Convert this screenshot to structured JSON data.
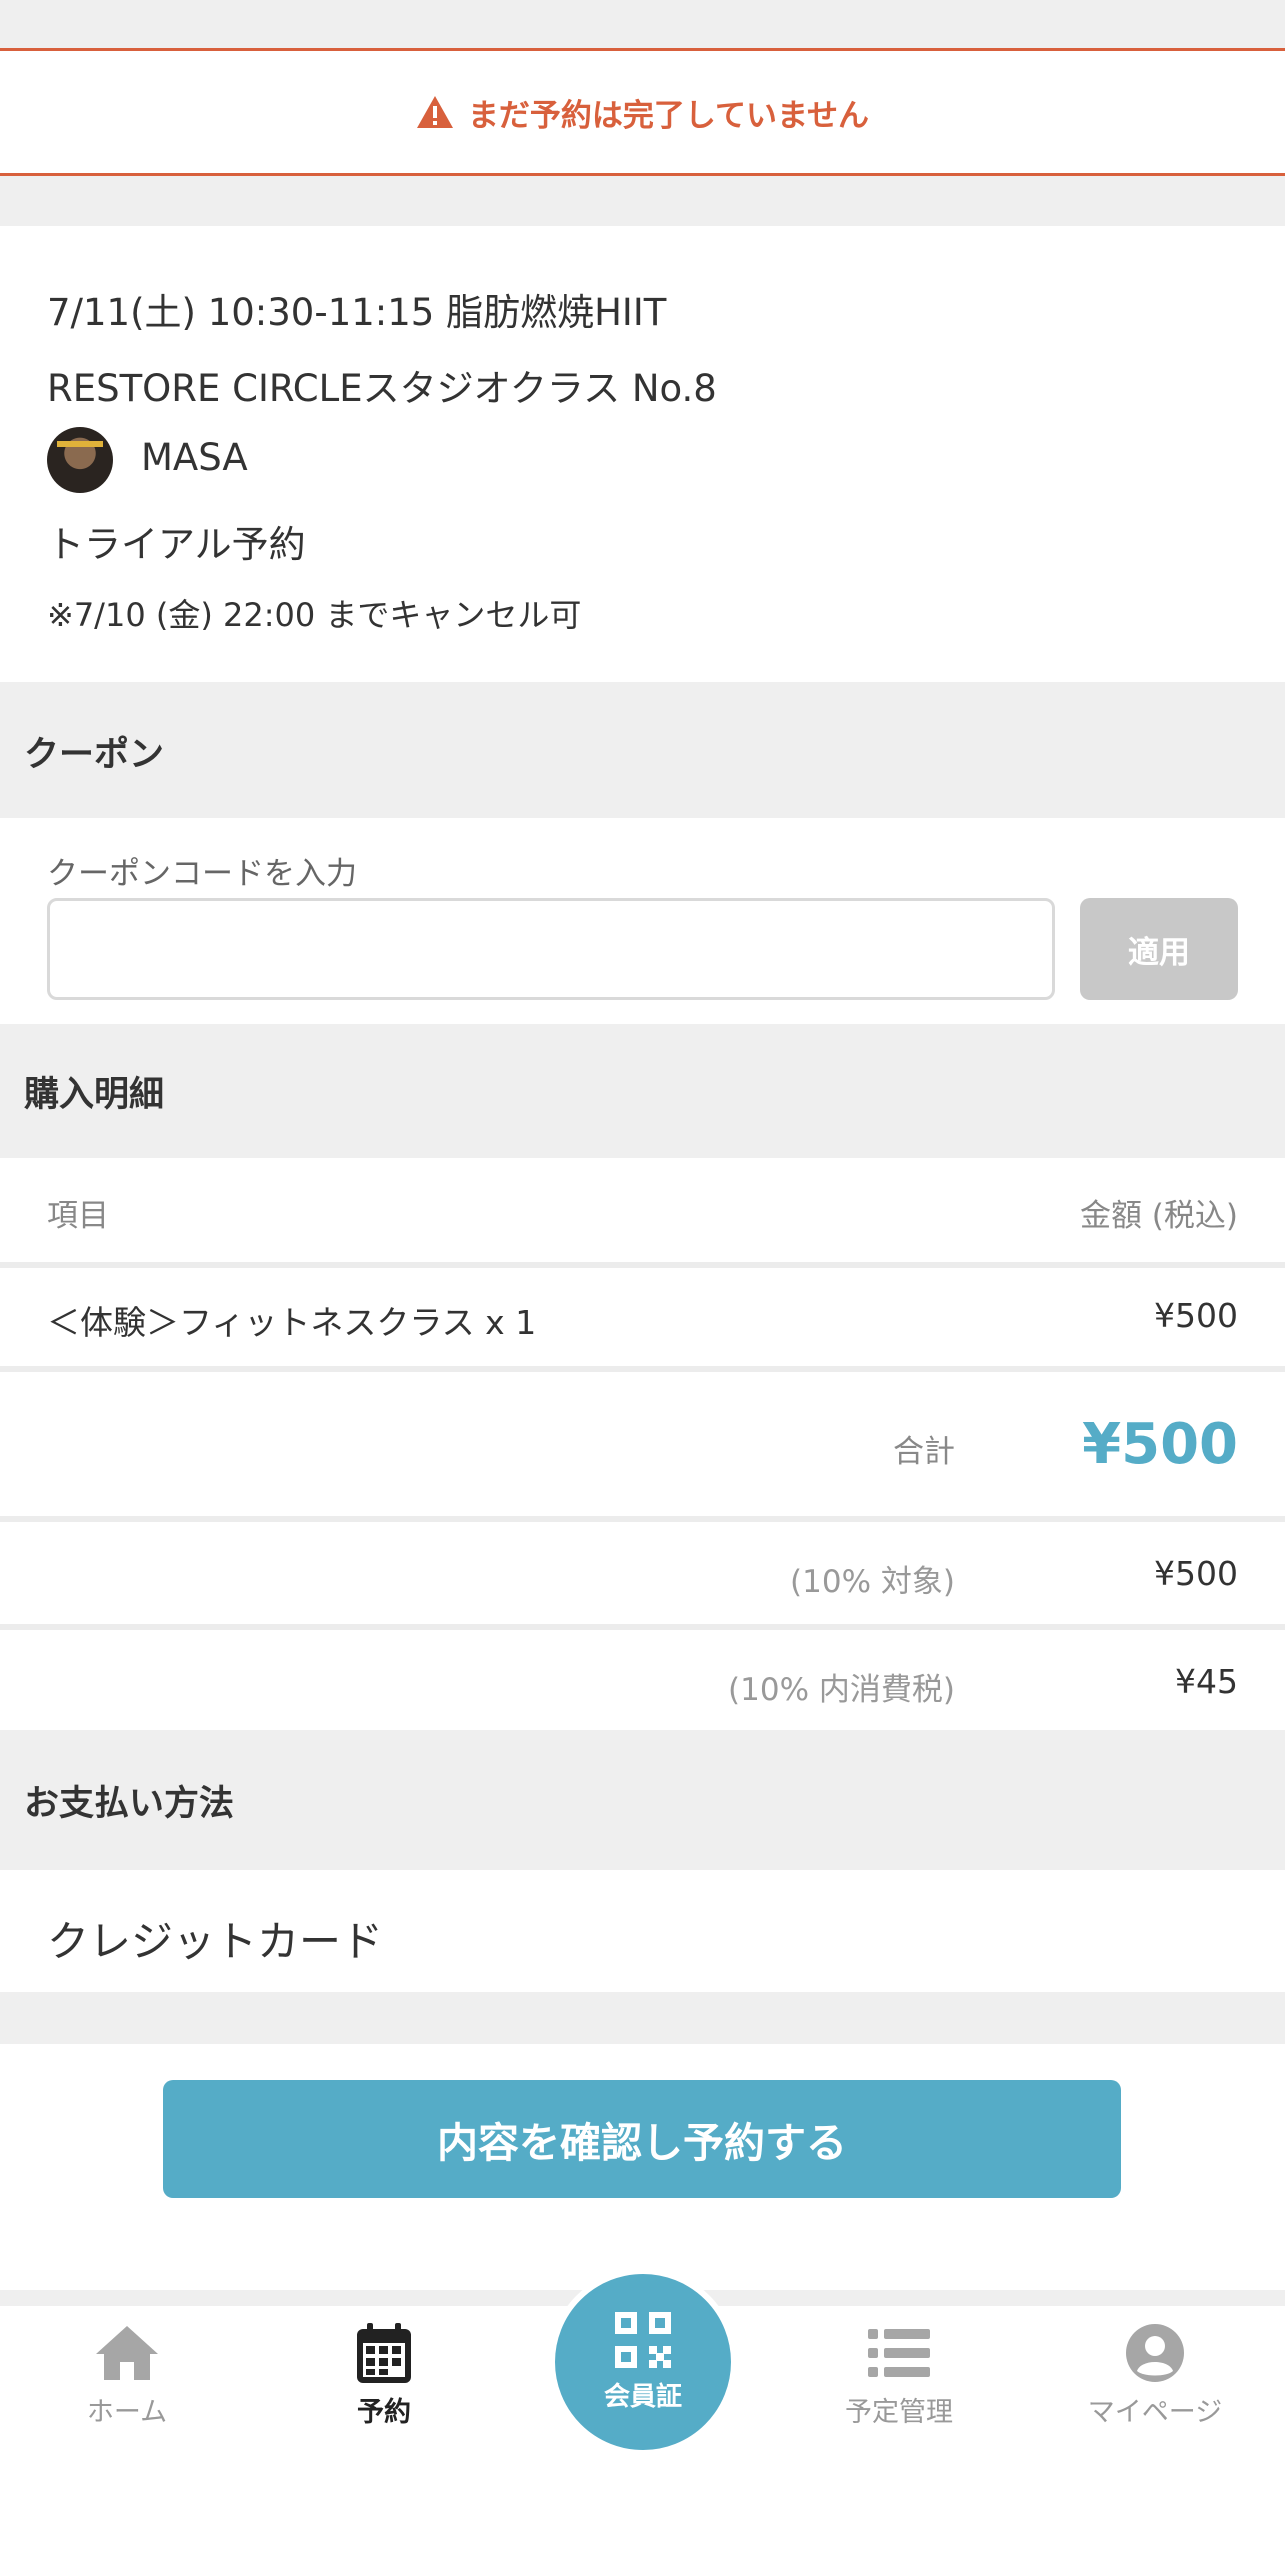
{
  "warning": {
    "text": "まだ予約は完了していません"
  },
  "lesson": {
    "datetime_title": "7/11(土) 10:30-11:15 脂肪燃焼HIIT",
    "studio": "RESTORE CIRCLEスタジオクラス No.8",
    "instructor": "MASA",
    "type": "トライアル予約",
    "cancel_note": "※7/10 (金) 22:00 までキャンセル可"
  },
  "coupon": {
    "heading": "クーポン",
    "label": "クーポンコードを入力",
    "value": "",
    "apply_label": "適用"
  },
  "purchase": {
    "heading": "購入明細",
    "col_item": "項目",
    "col_amount": "金額 (税込)",
    "items": [
      {
        "name": "＜体験＞フィットネスクラス x 1",
        "amount": "¥500"
      }
    ],
    "total_label": "合計",
    "total_value": "¥500",
    "taxable_label": "(10% 対象)",
    "taxable_value": "¥500",
    "tax_label": "(10% 内消費税)",
    "tax_value": "¥45"
  },
  "payment": {
    "heading": "お支払い方法",
    "method": "クレジットカード"
  },
  "cta": {
    "label": "内容を確認し予約する"
  },
  "tabbar": {
    "home": "ホーム",
    "reserve": "予約",
    "member_card": "会員証",
    "schedule": "予定管理",
    "mypage": "マイページ"
  },
  "colors": {
    "accent": "#55acc7",
    "warning": "#d8603c"
  }
}
